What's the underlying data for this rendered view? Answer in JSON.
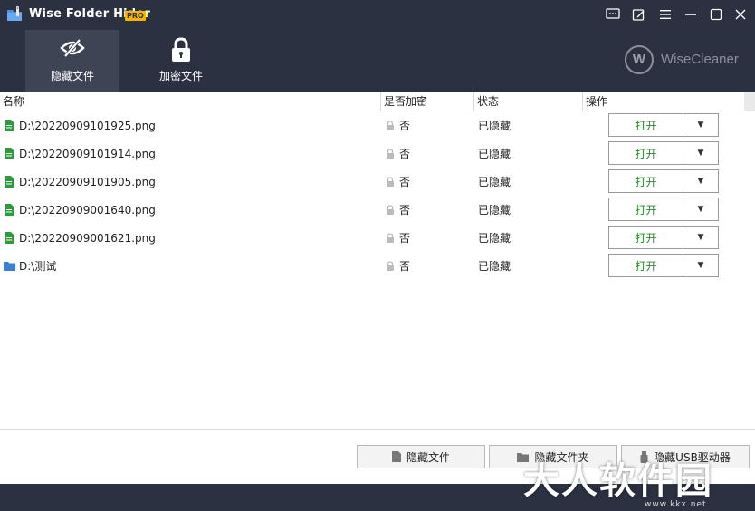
{
  "app": {
    "title": "Wise Folder Hider",
    "badge": "PRO",
    "brand": "WiseCleaner",
    "brand_mark": "W"
  },
  "window_controls": [
    {
      "icon": "feedback-icon"
    },
    {
      "icon": "edit-icon"
    },
    {
      "icon": "menu-icon"
    },
    {
      "icon": "minimize-icon"
    },
    {
      "icon": "maximize-icon"
    },
    {
      "icon": "close-icon"
    }
  ],
  "tabs": [
    {
      "label": "隐藏文件",
      "icon": "eye-slash-icon",
      "active": true
    },
    {
      "label": "加密文件",
      "icon": "lock-icon",
      "active": false
    }
  ],
  "columns": {
    "name": "名称",
    "encrypted": "是否加密",
    "status": "状态",
    "action": "操作"
  },
  "rows": [
    {
      "type": "file",
      "name": "D:\\20220909101925.png",
      "encrypted": "否",
      "status": "已隐藏",
      "action_label": "打开",
      "dropdown": "▼"
    },
    {
      "type": "file",
      "name": "D:\\20220909101914.png",
      "encrypted": "否",
      "status": "已隐藏",
      "action_label": "打开",
      "dropdown": "▼"
    },
    {
      "type": "file",
      "name": "D:\\20220909101905.png",
      "encrypted": "否",
      "status": "已隐藏",
      "action_label": "打开",
      "dropdown": "▼"
    },
    {
      "type": "file",
      "name": "D:\\20220909001640.png",
      "encrypted": "否",
      "status": "已隐藏",
      "action_label": "打开",
      "dropdown": "▼"
    },
    {
      "type": "file",
      "name": "D:\\20220909001621.png",
      "encrypted": "否",
      "status": "已隐藏",
      "action_label": "打开",
      "dropdown": "▼"
    },
    {
      "type": "folder",
      "name": "D:\\测试",
      "encrypted": "否",
      "status": "已隐藏",
      "action_label": "打开",
      "dropdown": "▼"
    }
  ],
  "footer_buttons": [
    {
      "label": "隐藏文件",
      "icon": "file-icon"
    },
    {
      "label": "隐藏文件夹",
      "icon": "folder-icon"
    },
    {
      "label": "隐藏USB驱动器",
      "icon": "usb-icon"
    }
  ],
  "watermark": {
    "text": "大人软件园",
    "sub": "www.kkx.net"
  },
  "colors": {
    "header_bg": "#2b3140",
    "tab_active_bg": "#3d4454",
    "file_green": "#2e9a3e",
    "folder_blue": "#3b7fd6",
    "open_text": "#2a8a2a"
  }
}
